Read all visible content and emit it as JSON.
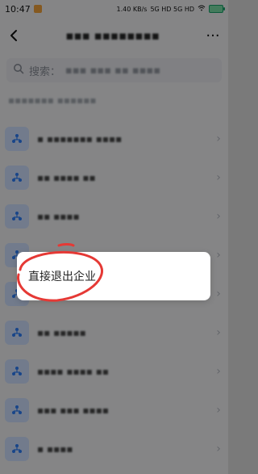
{
  "status": {
    "time": "10:47",
    "network_text": "1.40 KB/s",
    "signal_text": "5G HD 5G HD",
    "accent_battery": "#17a36a"
  },
  "header": {
    "title": "▪▪▪ ▪▪▪▪▪▪▪▪",
    "more_label": "···"
  },
  "search": {
    "placeholder": "搜索：",
    "value": "▪▪▪ ▪▪▪ ▪▪ ▪▪▪▪"
  },
  "section": {
    "label": "▪▪▪▪▪▪▪ ▪▪▪▪▪▪"
  },
  "list": {
    "items": [
      {
        "name": "▪ ▪▪▪▪▪▪▪ ▪▪▪▪"
      },
      {
        "name": "▪▪ ▪▪▪▪ ▪▪"
      },
      {
        "name": "▪▪ ▪▪▪▪"
      },
      {
        "name": "▪▪▪▪▪▪"
      },
      {
        "name": "▪▪▪▪▪▪▪ ▪"
      },
      {
        "name": "▪▪ ▪▪▪▪▪"
      },
      {
        "name": "▪▪▪▪ ▪▪▪▪ ▪▪"
      },
      {
        "name": "▪▪▪ ▪▪▪ ▪▪▪▪"
      },
      {
        "name": "▪ ▪▪▪▪"
      }
    ]
  },
  "popup": {
    "label": "直接退出企业"
  },
  "colors": {
    "annotation": "#e53935",
    "avatar_bg": "#cfe1ff",
    "avatar_fg": "#2d7ff9"
  }
}
